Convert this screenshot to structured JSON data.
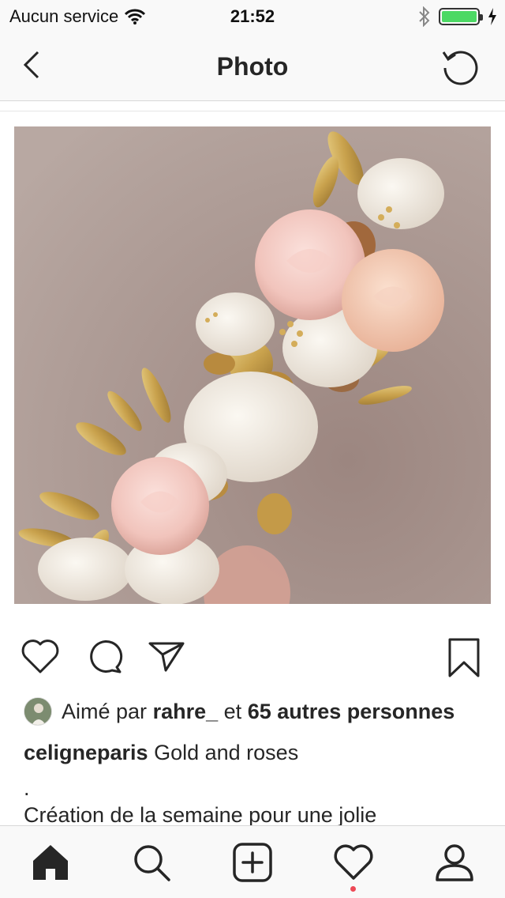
{
  "status_bar": {
    "carrier": "Aucun service",
    "time": "21:52",
    "battery_level": 1.0
  },
  "nav": {
    "title": "Photo"
  },
  "post": {
    "likes": {
      "prefix": "Aimé par",
      "user": "rahre_",
      "connector": "et",
      "others": "65 autres personnes"
    },
    "caption": {
      "user": "celigneparis",
      "text": "Gold and roses",
      "line2": ".",
      "line3": "Création de la semaine pour une jolie"
    }
  },
  "colors": {
    "text": "#262626",
    "background": "#ffffff",
    "bar": "#f9f9f9",
    "notification": "#ed4956",
    "battery": "#4cd964"
  },
  "icons": {
    "back": "chevron-left-icon",
    "refresh": "refresh-icon",
    "like": "heart-icon",
    "comment": "comment-icon",
    "share": "send-icon",
    "save": "bookmark-icon",
    "home": "home-icon",
    "search": "search-icon",
    "add": "plus-square-icon",
    "activity": "heart-icon",
    "profile": "profile-icon"
  }
}
